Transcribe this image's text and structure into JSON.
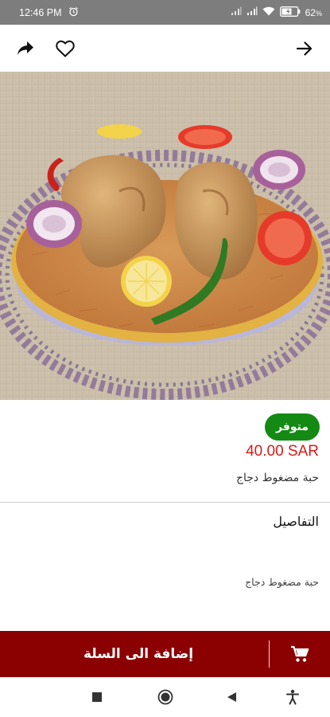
{
  "status_bar": {
    "time": "12:46 PM",
    "battery": "62",
    "icons": [
      "alarm-icon",
      "signal-icon",
      "signal-icon",
      "wifi-icon",
      "battery-icon"
    ]
  },
  "app_bar": {
    "icons": [
      "share-icon",
      "favorite-icon",
      "back-arrow-icon"
    ]
  },
  "product": {
    "availability": "متوفر",
    "price": "40.00 SAR",
    "name": "حبة مضغوط دجاج"
  },
  "details": {
    "title": "التفاصيل",
    "text": "حبة مضغوط دجاج"
  },
  "cart": {
    "label": "إضافة الى السلة",
    "icon": "cart-icon"
  },
  "nav_bar": {
    "icons": [
      "recents-icon",
      "home-icon",
      "back-icon",
      "accessibility-icon"
    ]
  },
  "colors": {
    "status_bar": "#7d7d7d",
    "badge_green": "#148a14",
    "price_red": "#d61a1a",
    "cart_bar": "#8b0000"
  }
}
